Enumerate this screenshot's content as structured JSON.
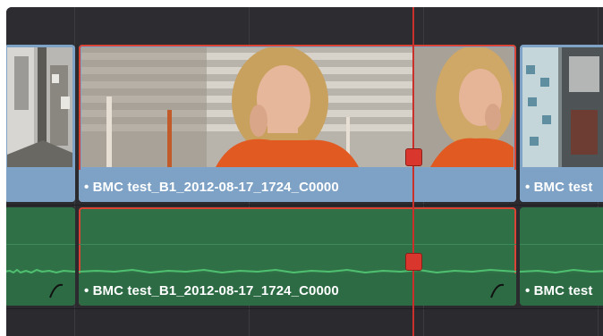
{
  "timeline": {
    "clips": {
      "left_video": {
        "label": ""
      },
      "center_video": {
        "label": "• BMC test_B1_2012-08-17_1724_C0000"
      },
      "right_video": {
        "label": "• BMC test"
      },
      "center_audio": {
        "label": "• BMC test_B1_2012-08-17_1724_C0000"
      },
      "right_audio": {
        "label": "• BMC test"
      }
    },
    "colors": {
      "video_clip": "#7ea2c6",
      "audio_clip": "#2d6b44",
      "selection": "#d94434",
      "playhead": "#c9302c",
      "background": "#2b2b2f"
    },
    "icons": [
      "audio-curve-icon",
      "playhead-marker-icon"
    ]
  }
}
